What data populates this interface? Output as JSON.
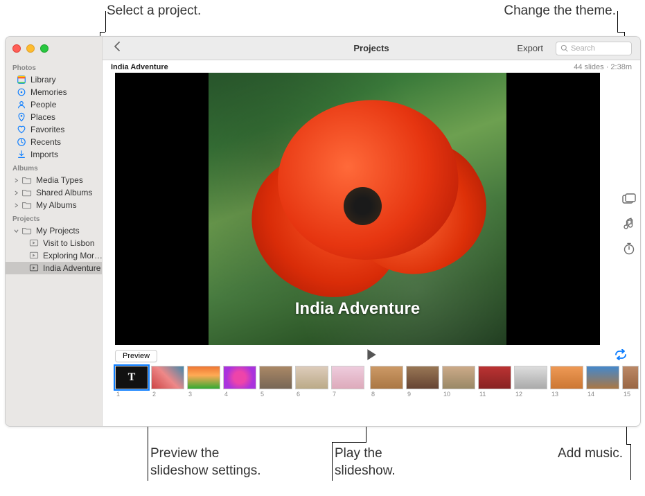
{
  "callouts": {
    "select_project": "Select a project.",
    "change_theme": "Change the theme.",
    "preview_settings": "Preview the\nslideshow settings.",
    "play_slideshow": "Play the\nslideshow.",
    "add_music": "Add music."
  },
  "toolbar": {
    "title": "Projects",
    "export_label": "Export",
    "search_placeholder": "Search"
  },
  "sidebar": {
    "sections": {
      "photos": "Photos",
      "albums": "Albums",
      "projects": "Projects"
    },
    "photos_items": [
      {
        "label": "Library"
      },
      {
        "label": "Memories"
      },
      {
        "label": "People"
      },
      {
        "label": "Places"
      },
      {
        "label": "Favorites"
      },
      {
        "label": "Recents"
      },
      {
        "label": "Imports"
      }
    ],
    "albums_items": [
      {
        "label": "Media Types"
      },
      {
        "label": "Shared Albums"
      },
      {
        "label": "My Albums"
      }
    ],
    "projects_root": "My Projects",
    "project_items": [
      {
        "label": "Visit to Lisbon"
      },
      {
        "label": "Exploring Mor…"
      },
      {
        "label": "India Adventure",
        "selected": true
      }
    ]
  },
  "main": {
    "title": "India Adventure",
    "status": "44 slides · 2:38m",
    "slide_title": "India Adventure",
    "preview_label": "Preview"
  },
  "thumbs": [
    {
      "n": "1",
      "title": true
    },
    {
      "n": "2"
    },
    {
      "n": "3"
    },
    {
      "n": "4"
    },
    {
      "n": "5"
    },
    {
      "n": "6"
    },
    {
      "n": "7"
    },
    {
      "n": "8"
    },
    {
      "n": "9"
    },
    {
      "n": "10"
    },
    {
      "n": "11"
    },
    {
      "n": "12"
    },
    {
      "n": "13"
    },
    {
      "n": "14"
    },
    {
      "n": "15"
    }
  ]
}
